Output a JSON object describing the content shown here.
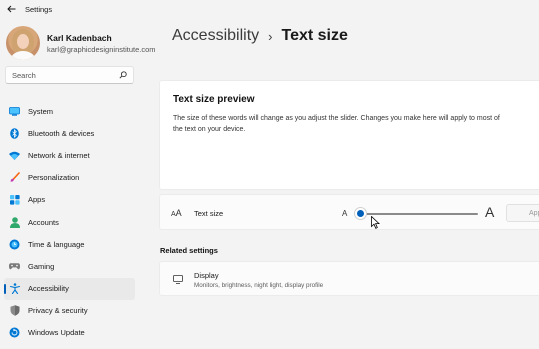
{
  "window": {
    "title": "Settings"
  },
  "profile": {
    "name": "Karl Kadenbach",
    "email": "karl@graphicdesigninstitute.com"
  },
  "search": {
    "placeholder": "Search"
  },
  "nav": {
    "items": [
      {
        "label": "System",
        "icon": "system-icon",
        "active": false
      },
      {
        "label": "Bluetooth & devices",
        "icon": "bluetooth-icon",
        "active": false
      },
      {
        "label": "Network & internet",
        "icon": "wifi-icon",
        "active": false
      },
      {
        "label": "Personalization",
        "icon": "brush-icon",
        "active": false
      },
      {
        "label": "Apps",
        "icon": "apps-icon",
        "active": false
      },
      {
        "label": "Accounts",
        "icon": "accounts-icon",
        "active": false
      },
      {
        "label": "Time & language",
        "icon": "globe-clock-icon",
        "active": false
      },
      {
        "label": "Gaming",
        "icon": "gamepad-icon",
        "active": false
      },
      {
        "label": "Accessibility",
        "icon": "accessibility-icon",
        "active": true
      },
      {
        "label": "Privacy & security",
        "icon": "shield-icon",
        "active": false
      },
      {
        "label": "Windows Update",
        "icon": "update-icon",
        "active": false
      }
    ]
  },
  "header": {
    "parent": "Accessibility",
    "separator": "›",
    "current": "Text size"
  },
  "preview": {
    "title": "Text size preview",
    "description": "The size of these words will change as you adjust the slider. Changes you make here will apply to most of the text on your device."
  },
  "text_size": {
    "icon_small": "A",
    "icon_big": "A",
    "label": "Text size",
    "small_marker": "A",
    "large_marker": "A",
    "slider_value": 0.02,
    "apply_label": "Apply"
  },
  "related": {
    "title": "Related settings",
    "display_title": "Display",
    "display_subtitle": "Monitors, brightness, night light, display profile"
  },
  "colors": {
    "accent": "#005fb8",
    "background": "#f3f3f3"
  }
}
